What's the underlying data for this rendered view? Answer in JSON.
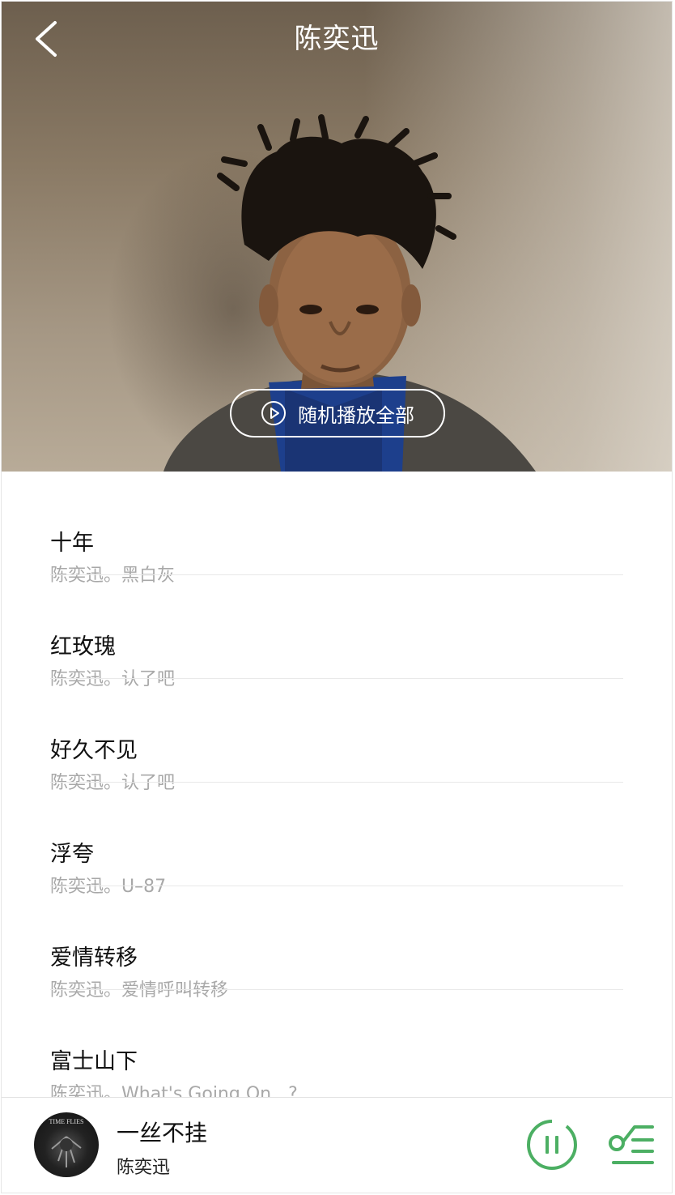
{
  "header": {
    "title": "陈奕迅",
    "back_icon": "chevron-left-icon"
  },
  "hero": {
    "shuffle_label": "随机播放全部",
    "shuffle_icon": "play-circle-icon"
  },
  "songs": [
    {
      "title": "十年",
      "subtitle": "陈奕迅。黑白灰"
    },
    {
      "title": "红玫瑰",
      "subtitle": "陈奕迅。认了吧"
    },
    {
      "title": "好久不见",
      "subtitle": "陈奕迅。认了吧"
    },
    {
      "title": "浮夸",
      "subtitle": "陈奕迅。U–87"
    },
    {
      "title": "爱情转移",
      "subtitle": "陈奕迅。爱情呼叫转移"
    },
    {
      "title": "富士山下",
      "subtitle": "陈奕迅。What's Going On...?"
    }
  ],
  "player": {
    "title": "一丝不挂",
    "artist": "陈奕迅",
    "album_art_text": "TIME FLIES",
    "pause_icon": "pause-circle-icon",
    "playlist_icon": "playlist-icon",
    "accent": "#4caf63"
  }
}
